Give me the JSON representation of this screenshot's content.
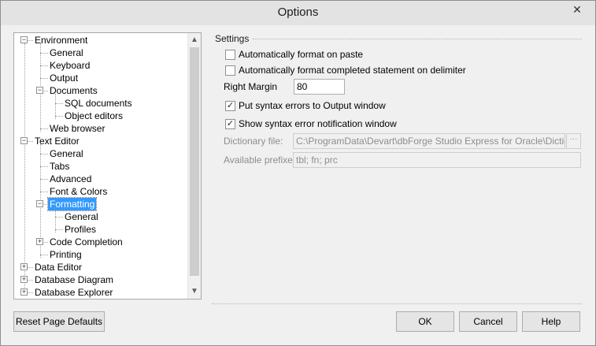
{
  "window": {
    "title": "Options",
    "close_icon": "close-icon"
  },
  "tree": {
    "items": [
      {
        "label": "Environment",
        "expander": "−"
      },
      {
        "label": "General"
      },
      {
        "label": "Keyboard"
      },
      {
        "label": "Output"
      },
      {
        "label": "Documents",
        "expander": "−"
      },
      {
        "label": "SQL documents"
      },
      {
        "label": "Object editors"
      },
      {
        "label": "Web browser"
      },
      {
        "label": "Text Editor",
        "expander": "−"
      },
      {
        "label": "General"
      },
      {
        "label": "Tabs"
      },
      {
        "label": "Advanced"
      },
      {
        "label": "Font & Colors"
      },
      {
        "label": "Formatting",
        "expander": "−",
        "selected": true
      },
      {
        "label": "General"
      },
      {
        "label": "Profiles"
      },
      {
        "label": "Code Completion",
        "expander": "+"
      },
      {
        "label": "Printing"
      },
      {
        "label": "Data Editor",
        "expander": "+"
      },
      {
        "label": "Database Diagram",
        "expander": "+"
      },
      {
        "label": "Database Explorer",
        "expander": "+"
      }
    ]
  },
  "settings": {
    "legend": "Settings",
    "auto_format_paste": {
      "label": "Automatically format on paste",
      "checked": false
    },
    "auto_format_delimiter": {
      "label": "Automatically format completed statement on delimiter",
      "checked": false
    },
    "right_margin": {
      "label": "Right Margin",
      "value": "80"
    },
    "syntax_errors_output": {
      "label": "Put syntax errors to Output window",
      "checked": true
    },
    "syntax_error_notification": {
      "label": "Show syntax error notification window",
      "checked": true
    },
    "dictionary_file": {
      "label": "Dictionary file:",
      "value": "C:\\ProgramData\\Devart\\dbForge Studio Express for Oracle\\Dictionaries\\",
      "browse_label": "···"
    },
    "available_prefixes": {
      "label": "Available prefixes:",
      "value": "tbl; fn; prc"
    }
  },
  "buttons": {
    "reset": "Reset Page Defaults",
    "ok": "OK",
    "cancel": "Cancel",
    "help": "Help"
  },
  "icons": {
    "check": "✓",
    "scroll_up": "▲",
    "scroll_down": "▼",
    "close": "✕"
  },
  "colors": {
    "selection": "#3399ff",
    "window_bg": "#f0f0f0"
  }
}
